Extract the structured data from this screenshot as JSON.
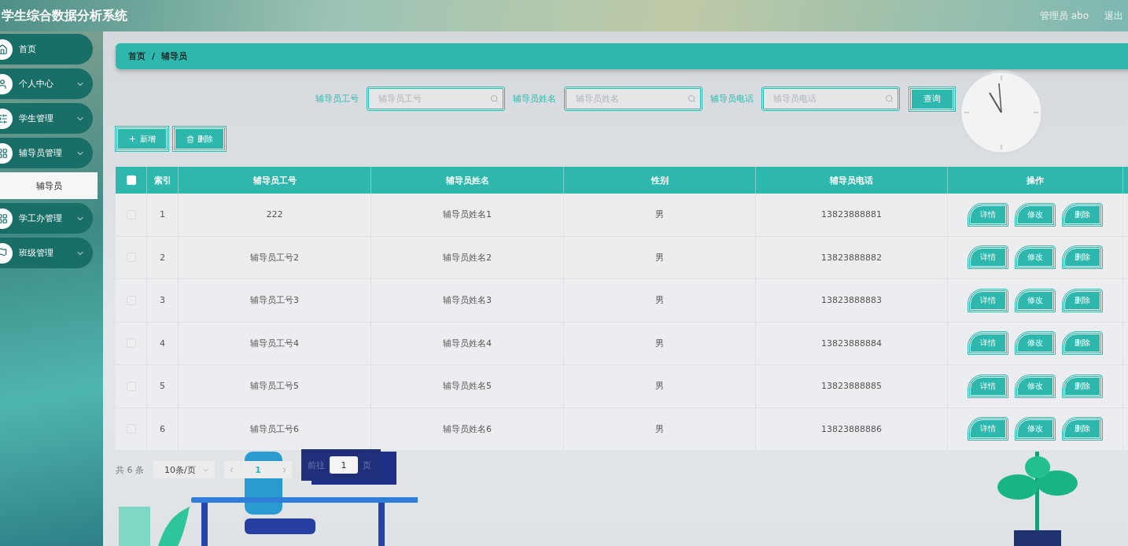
{
  "header": {
    "title": "学生综合数据分析系统",
    "user": "管理员 abo",
    "logout": "退出"
  },
  "sidebar": {
    "items": [
      {
        "label": "首页",
        "kind": "link"
      },
      {
        "label": "个人中心",
        "kind": "menu"
      },
      {
        "label": "学生管理",
        "kind": "menu"
      },
      {
        "label": "辅导员管理",
        "kind": "menu",
        "children": [
          {
            "label": "辅导员",
            "selected": true
          }
        ]
      },
      {
        "label": "学工办管理",
        "kind": "menu"
      },
      {
        "label": "班级管理",
        "kind": "menu"
      }
    ]
  },
  "breadcrumb": [
    "首页",
    "辅导员"
  ],
  "breadcrumb_separator": "/",
  "search": {
    "fields": [
      {
        "label": "辅导员工号",
        "placeholder": "辅导员工号"
      },
      {
        "label": "辅导员姓名",
        "placeholder": "辅导员姓名"
      },
      {
        "label": "辅导员电话",
        "placeholder": "辅导员电话"
      }
    ],
    "button": "查询"
  },
  "actions": [
    {
      "label": "新增",
      "kind": "add"
    },
    {
      "label": "删除",
      "kind": "delete"
    }
  ],
  "table": {
    "header_checked": false,
    "columns": [
      "索引",
      "辅导员工号",
      "辅导员姓名",
      "性别",
      "辅导员电话",
      "操作"
    ],
    "rows": [
      {
        "selected": false,
        "cells": [
          "1",
          "222",
          "辅导员姓名1",
          "男",
          "13823888881"
        ],
        "actions": [
          "详情",
          "修改",
          "删除"
        ]
      },
      {
        "selected": false,
        "cells": [
          "2",
          "辅导员工号2",
          "辅导员姓名2",
          "男",
          "13823888882"
        ],
        "actions": [
          "详情",
          "修改",
          "删除"
        ]
      },
      {
        "selected": false,
        "cells": [
          "3",
          "辅导员工号3",
          "辅导员姓名3",
          "男",
          "13823888883"
        ],
        "actions": [
          "详情",
          "修改",
          "删除"
        ]
      },
      {
        "selected": false,
        "cells": [
          "4",
          "辅导员工号4",
          "辅导员姓名4",
          "男",
          "13823888884"
        ],
        "actions": [
          "详情",
          "修改",
          "删除"
        ]
      },
      {
        "selected": false,
        "cells": [
          "5",
          "辅导员工号5",
          "辅导员姓名5",
          "男",
          "13823888885"
        ],
        "actions": [
          "详情",
          "修改",
          "删除"
        ]
      },
      {
        "selected": false,
        "cells": [
          "6",
          "辅导员工号6",
          "辅导员姓名6",
          "男",
          "13823888886"
        ],
        "actions": [
          "详情",
          "修改",
          "删除"
        ]
      }
    ]
  },
  "pagination": {
    "total": "共 6 条",
    "page_size": "10条/页",
    "pages": [
      {
        "label": "1",
        "selected": true
      }
    ],
    "goto_prefix": "前往",
    "goto_value": "1",
    "goto_suffix": "页"
  }
}
